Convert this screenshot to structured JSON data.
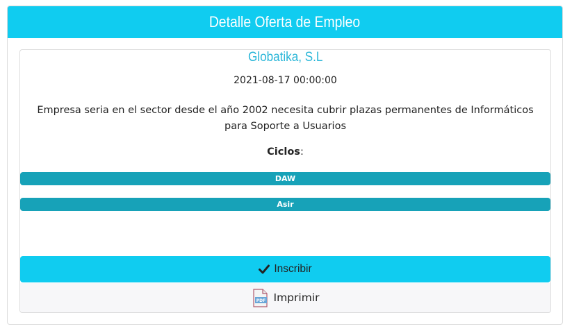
{
  "header": {
    "title": "Detalle Oferta de Empleo"
  },
  "offer": {
    "company": "Globatika, S.L",
    "date": "2021-08-17 00:00:00",
    "description": "Empresa seria en el sector desde el año 2002 necesita cubrir plazas permanentes de Informáticos para Soporte a Usuarios",
    "ciclos_label": "Ciclos",
    "ciclos_colon": ":",
    "ciclos": [
      "DAW",
      "Asir"
    ]
  },
  "actions": {
    "inscribir_label": "Inscribir",
    "imprimir_label": "Imprimir",
    "pdf_icon_text": "PDF"
  },
  "colors": {
    "header": "#10ccf0",
    "company": "#29b6d8",
    "badge": "#17a2b8",
    "inscribir": "#10ccf0"
  },
  "icons": {
    "inscribir": "check-icon",
    "imprimir": "pdf-icon"
  }
}
